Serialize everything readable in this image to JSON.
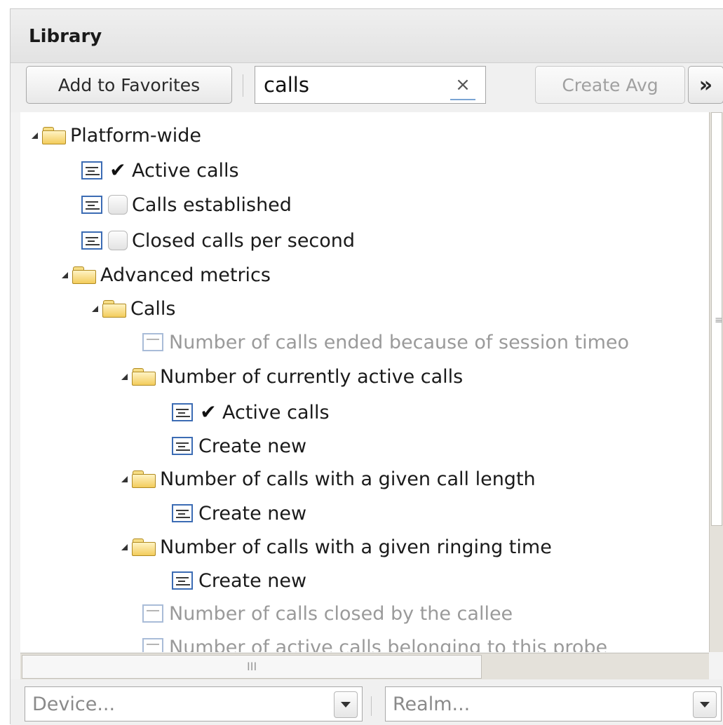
{
  "panel": {
    "title": "Library"
  },
  "toolbar": {
    "add_favorites_label": "Add to Favorites",
    "search_value": "calls",
    "clear_label": "×",
    "create_avg_label": "Create Avg",
    "more_label": "»"
  },
  "tree": {
    "rows": [
      {
        "label": "Platform-wide",
        "type": "folder",
        "expanded": true,
        "faded": false
      },
      {
        "label": "Active calls",
        "type": "metric",
        "checkbox": "checked",
        "faded": false
      },
      {
        "label": "Calls established",
        "type": "metric",
        "checkbox": "unchecked",
        "faded": false
      },
      {
        "label": "Closed calls per second",
        "type": "metric",
        "checkbox": "unchecked",
        "faded": false
      },
      {
        "label": "Advanced metrics",
        "type": "folder",
        "expanded": true,
        "faded": false
      },
      {
        "label": "Calls",
        "type": "folder",
        "expanded": true,
        "faded": false
      },
      {
        "label": "Number of calls ended because of session timeo",
        "type": "metric",
        "checkbox": "none",
        "faded": true
      },
      {
        "label": "Number of currently active calls",
        "type": "folder",
        "expanded": true,
        "faded": false
      },
      {
        "label": "Active calls",
        "type": "metric",
        "checkbox": "checked",
        "faded": false
      },
      {
        "label": "Create new",
        "type": "metric",
        "checkbox": "none",
        "faded": false
      },
      {
        "label": "Number of calls with a given call length",
        "type": "folder",
        "expanded": true,
        "faded": false
      },
      {
        "label": "Create new",
        "type": "metric",
        "checkbox": "none",
        "faded": false
      },
      {
        "label": "Number of calls with a given ringing time",
        "type": "folder",
        "expanded": true,
        "faded": false
      },
      {
        "label": "Create new",
        "type": "metric",
        "checkbox": "none",
        "faded": false
      },
      {
        "label": "Number of calls closed by the callee",
        "type": "metric",
        "checkbox": "none",
        "faded": true
      },
      {
        "label": "Number of active calls belonging to this probe",
        "type": "metric",
        "checkbox": "none",
        "faded": true
      }
    ]
  },
  "scrollbars": {
    "horizontal_grip": "III",
    "vertical_grip": "≡"
  },
  "footer": {
    "device_placeholder": "Device...",
    "realm_placeholder": "Realm..."
  }
}
